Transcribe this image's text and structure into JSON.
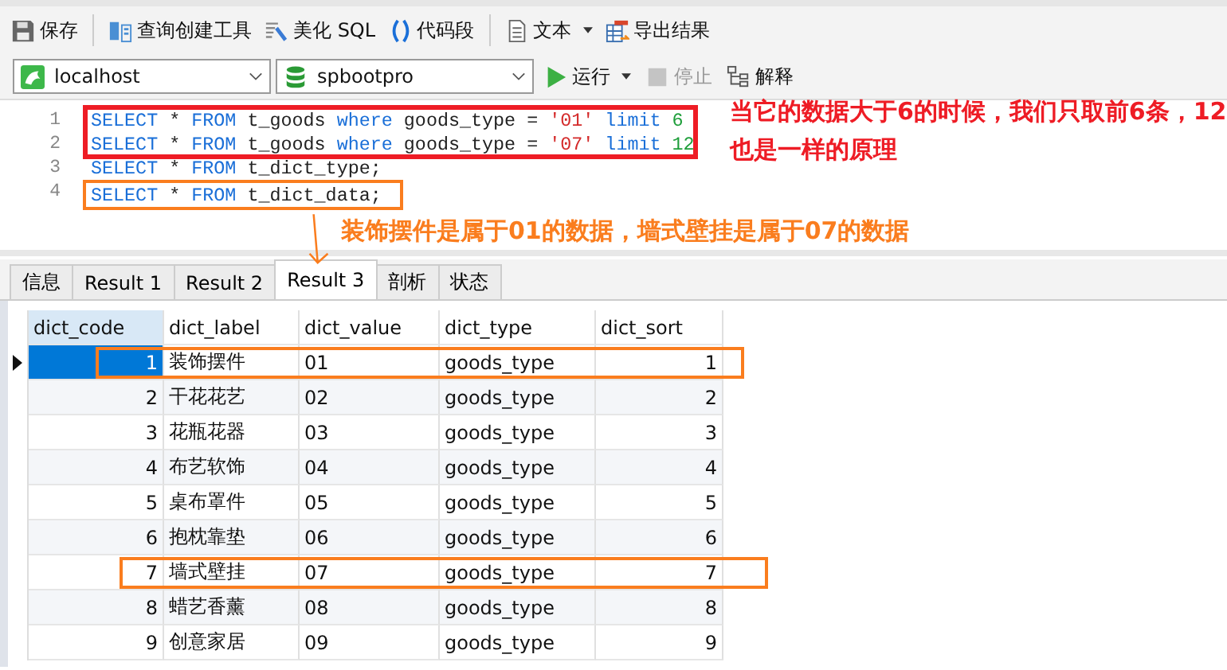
{
  "toolbar": [
    {
      "label": "保存",
      "caret": false
    },
    {
      "label": "查询创建工具",
      "caret": false
    },
    {
      "label": "美化 SQL",
      "caret": false
    },
    {
      "label": "代码段",
      "caret": false
    },
    {
      "label": "文本",
      "caret": true
    },
    {
      "label": "导出结果",
      "caret": false
    }
  ],
  "connection": {
    "value": "localhost"
  },
  "database": {
    "value": "spbootpro"
  },
  "run_button": {
    "label": "运行",
    "disabled": false
  },
  "stop_button": {
    "label": "停止",
    "disabled": true
  },
  "explain_button": {
    "label": "解释",
    "disabled": false
  },
  "editor": {
    "lines": [
      {
        "number": "1",
        "tokens": [
          {
            "text": "SELECT",
            "kind": "kw"
          },
          {
            "text": " * ",
            "kind": "id"
          },
          {
            "text": "FROM",
            "kind": "kw"
          },
          {
            "text": " t_goods ",
            "kind": "id"
          },
          {
            "text": "where",
            "kind": "kw"
          },
          {
            "text": " goods_type = ",
            "kind": "id"
          },
          {
            "text": "'01'",
            "kind": "str"
          },
          {
            "text": " limit",
            "kind": "kw"
          },
          {
            "text": " 6",
            "kind": "num"
          }
        ]
      },
      {
        "number": "2",
        "tokens": [
          {
            "text": "SELECT",
            "kind": "kw"
          },
          {
            "text": " * ",
            "kind": "id"
          },
          {
            "text": "FROM",
            "kind": "kw"
          },
          {
            "text": " t_goods ",
            "kind": "id"
          },
          {
            "text": "where",
            "kind": "kw"
          },
          {
            "text": " goods_type = ",
            "kind": "id"
          },
          {
            "text": "'07'",
            "kind": "str"
          },
          {
            "text": " limit",
            "kind": "kw"
          },
          {
            "text": " 12",
            "kind": "num"
          }
        ]
      },
      {
        "number": "3",
        "tokens": [
          {
            "text": "SELECT",
            "kind": "kw"
          },
          {
            "text": " * ",
            "kind": "id"
          },
          {
            "text": "FROM",
            "kind": "kw"
          },
          {
            "text": " t_dict_type;",
            "kind": "id"
          }
        ]
      },
      {
        "number": "4",
        "tokens": [
          {
            "text": "SELECT",
            "kind": "kw"
          },
          {
            "text": " * ",
            "kind": "id"
          },
          {
            "text": "FROM",
            "kind": "kw"
          },
          {
            "text": " t_dict_data;",
            "kind": "id"
          }
        ]
      }
    ]
  },
  "annotations": [
    {
      "text": "当它的数据大于6的时候，我们只取前6条，12也是一样的原理",
      "color": "#ee1c25"
    },
    {
      "text": "装饰摆件是属于01的数据，墙式壁挂是属于07的数据",
      "color": "#fa7d1e"
    }
  ],
  "tabs": [
    {
      "label": "信息",
      "selected": false
    },
    {
      "label": "Result 1",
      "selected": false
    },
    {
      "label": "Result 2",
      "selected": false
    },
    {
      "label": "Result 3",
      "selected": true
    },
    {
      "label": "剖析",
      "selected": false
    },
    {
      "label": "状态",
      "selected": false
    }
  ],
  "table": {
    "columns": [
      "dict_code",
      "dict_label",
      "dict_value",
      "dict_type",
      "dict_sort"
    ],
    "rows": [
      {
        "cells": [
          "1",
          "装饰摆件",
          "01",
          "goods_type",
          "1"
        ],
        "selected": true,
        "highlighted": true
      },
      {
        "cells": [
          "2",
          "干花花艺",
          "02",
          "goods_type",
          "2"
        ],
        "selected": false,
        "highlighted": false
      },
      {
        "cells": [
          "3",
          "花瓶花器",
          "03",
          "goods_type",
          "3"
        ],
        "selected": false,
        "highlighted": false
      },
      {
        "cells": [
          "4",
          "布艺软饰",
          "04",
          "goods_type",
          "4"
        ],
        "selected": false,
        "highlighted": false
      },
      {
        "cells": [
          "5",
          "桌布罩件",
          "05",
          "goods_type",
          "5"
        ],
        "selected": false,
        "highlighted": false
      },
      {
        "cells": [
          "6",
          "抱枕靠垫",
          "06",
          "goods_type",
          "6"
        ],
        "selected": false,
        "highlighted": false
      },
      {
        "cells": [
          "7",
          "墙式壁挂",
          "07",
          "goods_type",
          "7"
        ],
        "selected": false,
        "highlighted": true
      },
      {
        "cells": [
          "8",
          "蜡艺香薰",
          "08",
          "goods_type",
          "8"
        ],
        "selected": false,
        "highlighted": false
      },
      {
        "cells": [
          "9",
          "创意家居",
          "09",
          "goods_type",
          "9"
        ],
        "selected": false,
        "highlighted": false
      }
    ]
  }
}
